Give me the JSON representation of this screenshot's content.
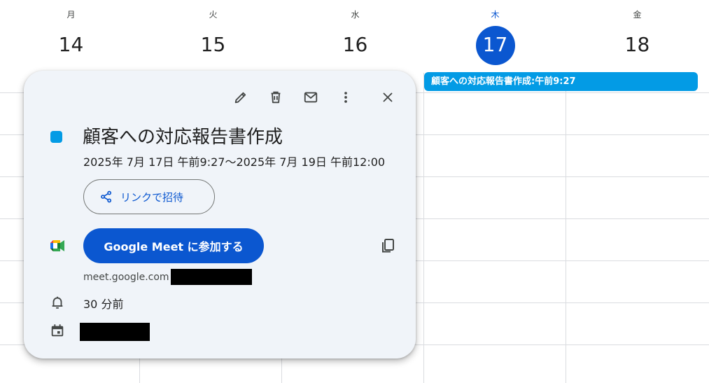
{
  "days": [
    {
      "name": "月",
      "num": "14",
      "today": false
    },
    {
      "name": "火",
      "num": "15",
      "today": false
    },
    {
      "name": "水",
      "num": "16",
      "today": false
    },
    {
      "name": "木",
      "num": "17",
      "today": true
    },
    {
      "name": "金",
      "num": "18",
      "today": false
    }
  ],
  "event_chip": {
    "label": "顧客への対応報告書作成:午前9:27"
  },
  "popover": {
    "title": "顧客への対応報告書作成",
    "date_range": "2025年 7月 17日 午前9:27～2025年 7月 19日 午前12:00",
    "invite_label": "リンクで招待",
    "meet_button_label": "Google Meet に参加する",
    "meet_link": "meet.google.com",
    "reminder": "30 分前"
  },
  "icons": {
    "edit": "pencil-icon",
    "delete": "trash-icon",
    "email": "mail-icon",
    "more": "more-vert-icon",
    "close": "close-icon",
    "share": "share-icon",
    "meet": "google-meet-icon",
    "copy": "copy-icon",
    "bell": "bell-icon",
    "calendar": "calendar-icon"
  },
  "colors": {
    "accent": "#0b57d0",
    "event": "#039be5",
    "card": "#f0f4f9"
  }
}
